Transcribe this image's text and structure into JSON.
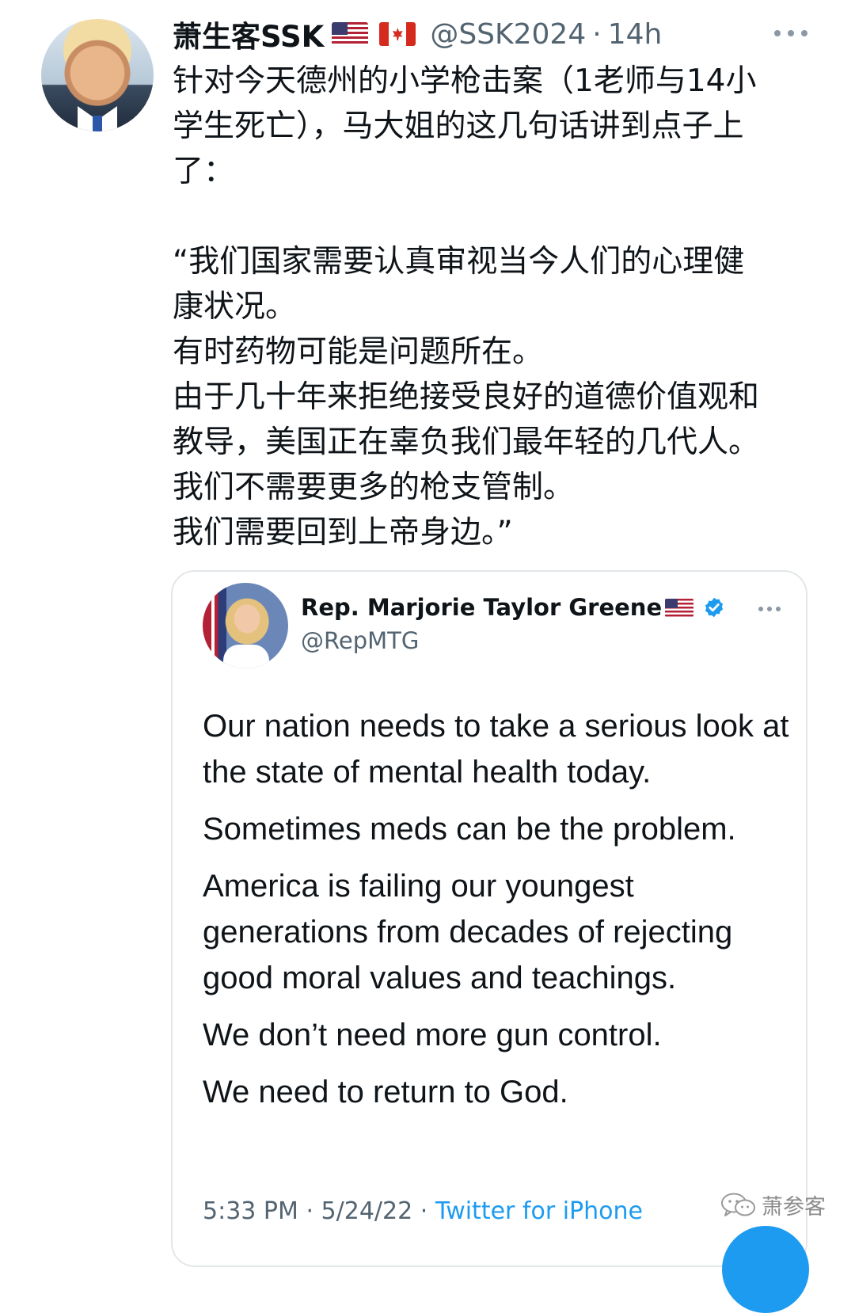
{
  "tweet": {
    "display_name": "萧生客SSK",
    "handle": "@SSK2024",
    "separator": "·",
    "time": "14h",
    "text_lines": [
      "针对今天德州的小学枪击案（1老师与14小",
      "学生死亡），马大姐的这几句话讲到点子上",
      "了："
    ],
    "quote_lines": [
      "“我们国家需要认真审视当今人们的心理健",
      "康状况。",
      "有时药物可能是问题所在。",
      "由于几十年来拒绝接受良好的道德价值观和",
      "教导，美国正在辜负我们最年轻的几代人。",
      "我们不需要更多的枪支管制。",
      "我们需要回到上帝身边。”"
    ]
  },
  "quoted": {
    "name": "Rep. Marjorie Taylor Greene",
    "handle": "@RepMTG",
    "paragraphs": [
      "Our nation needs to take a serious look at the state of mental health today.",
      "Sometimes meds can be the problem.",
      "America is failing our youngest generations from decades of rejecting good moral values and  teachings.",
      "We don’t need more gun control.",
      "We need to return to God."
    ],
    "time": "5:33 PM",
    "separator": "·",
    "date": "5/24/22",
    "source": "Twitter for iPhone"
  },
  "watermark": {
    "text": "萧参客"
  },
  "icons": {
    "more": "more-icon",
    "verified": "verified-badge-icon",
    "flag_us": "us-flag-icon",
    "flag_ca": "canada-flag-icon",
    "wechat": "wechat-icon"
  },
  "colors": {
    "text": "#0f1419",
    "secondary": "#536471",
    "link": "#1d9bf0",
    "border": "#e3e7ea"
  }
}
